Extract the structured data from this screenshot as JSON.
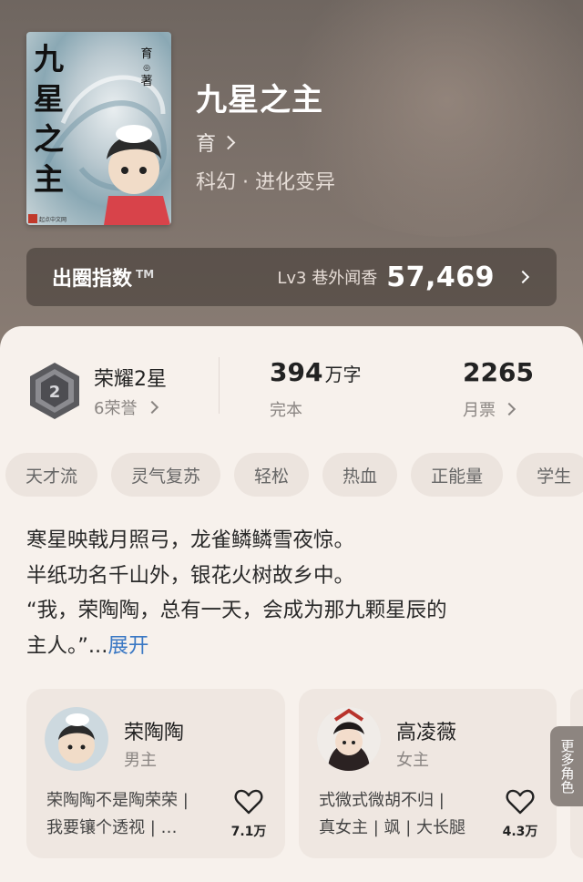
{
  "book": {
    "title": "九星之主",
    "author": "育",
    "genre": "科幻 · 进化变异",
    "cover_title": "九星之主",
    "cover_author": "育",
    "cover_author_suffix": "著",
    "cover_publisher": "起点中文网"
  },
  "popularity": {
    "label": "出圈指数",
    "trademark": "TM",
    "level": "Lv3 巷外闻香",
    "score": "57,469"
  },
  "stats": {
    "honor_title": "荣耀2星",
    "honor_sub": "6荣誉",
    "honor_badge_number": "2",
    "word_count": "394",
    "word_unit": "万字",
    "status": "完本",
    "monthly_tickets": "2265",
    "monthly_tickets_label": "月票"
  },
  "tags": [
    "天才流",
    "灵气复苏",
    "轻松",
    "热血",
    "正能量",
    "学生"
  ],
  "description": {
    "lines": [
      "寒星映戟月照弓，龙雀鳞鳞雪夜惊。",
      "半纸功名千山外，银花火树故乡中。",
      "“我，荣陶陶，总有一天，会成为那九颗星辰的",
      "主人。”..."
    ],
    "expand": "展开"
  },
  "characters": [
    {
      "name": "荣陶陶",
      "role": "男主",
      "desc_line1": "荣陶陶不是陶荣荣 |",
      "desc_line2": "我要镶个透视 | …",
      "likes": "7.1万"
    },
    {
      "name": "高凌薇",
      "role": "女主",
      "desc_line1": "式微式微胡不归 |",
      "desc_line2": "真女主 | 飒 | 大长腿",
      "likes": "4.3万"
    }
  ],
  "more_roles": "更多角色",
  "colors": {
    "accent_link": "#3a78c4",
    "panel_bg": "#f7f1ec",
    "hero_bg": "#7c716a"
  }
}
